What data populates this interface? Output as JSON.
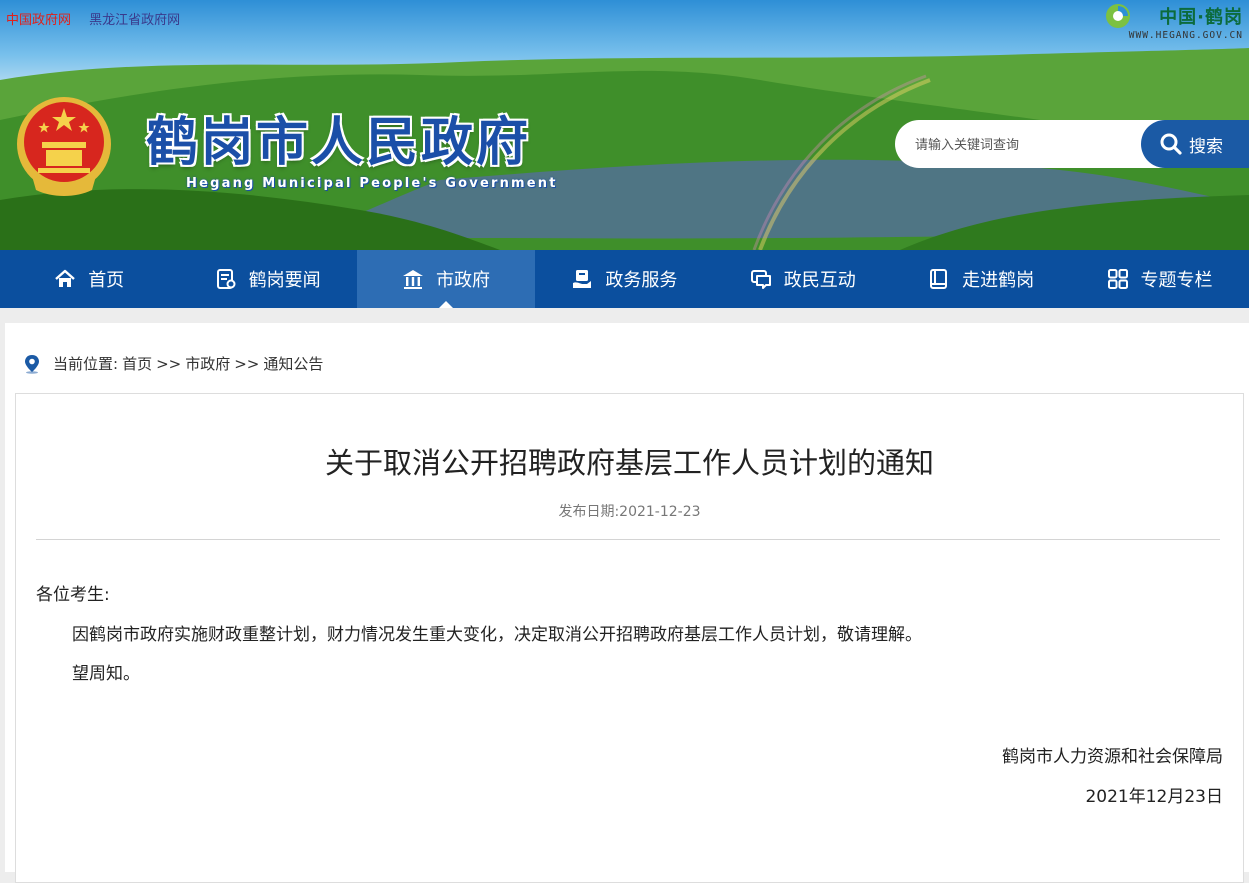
{
  "top_links": [
    "中国政府网",
    "黑龙江省政府网"
  ],
  "corner_logo": {
    "text": "中国·鹤岗",
    "url": "WWW.HEGANG.GOV.CN"
  },
  "site": {
    "title": "鹤岗市人民政府",
    "subtitle": "Hegang Municipal People's Government"
  },
  "search": {
    "placeholder": "请输入关键词查询",
    "button": "搜索"
  },
  "nav": [
    {
      "label": "首页",
      "icon": "home-icon"
    },
    {
      "label": "鹤岗要闻",
      "icon": "news-icon"
    },
    {
      "label": "市政府",
      "icon": "government-building-icon",
      "active": true
    },
    {
      "label": "政务服务",
      "icon": "service-icon"
    },
    {
      "label": "政民互动",
      "icon": "chat-icon"
    },
    {
      "label": "走进鹤岗",
      "icon": "book-icon"
    },
    {
      "label": "专题专栏",
      "icon": "grid-icon"
    }
  ],
  "breadcrumb": {
    "prefix": "当前位置:",
    "items": [
      "首页",
      "市政府",
      "通知公告"
    ],
    "separator": ">>"
  },
  "article": {
    "title": "关于取消公开招聘政府基层工作人员计划的通知",
    "date_label": "发布日期:",
    "date": "2021-12-23",
    "greeting": "各位考生:",
    "paragraphs": [
      "因鹤岗市政府实施财政重整计划，财力情况发生重大变化，决定取消公开招聘政府基层工作人员计划，敬请理解。",
      "望周知。"
    ],
    "signature": "鹤岗市人力资源和社会保障局",
    "signature_date": "2021年12月23日"
  },
  "colors": {
    "nav_bg": "#0b4f9e",
    "nav_active": "#2d6db4",
    "title_blue": "#1b4fa8",
    "link_red": "#e0201a"
  }
}
